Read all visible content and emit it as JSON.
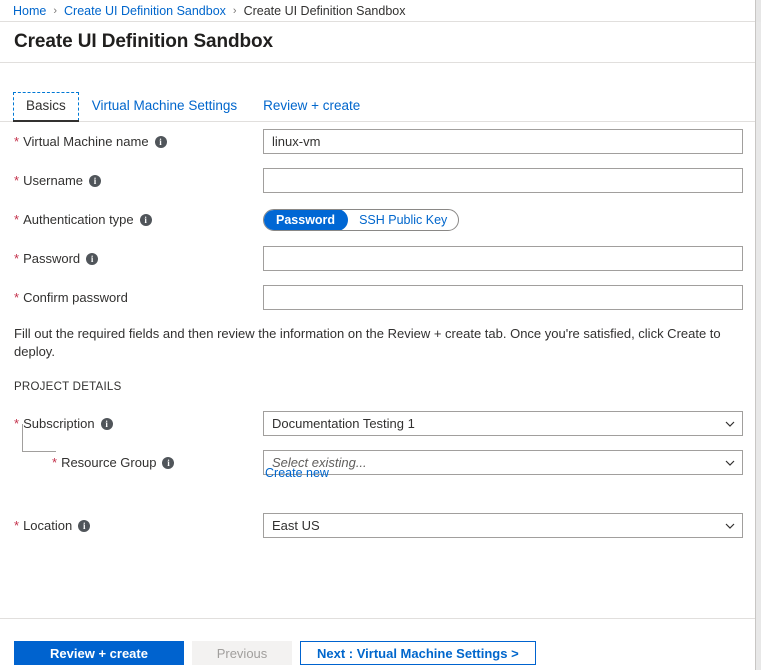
{
  "breadcrumb": {
    "items": [
      {
        "label": "Home",
        "type": "link"
      },
      {
        "label": "Create UI Definition Sandbox",
        "type": "link"
      },
      {
        "label": "Create UI Definition Sandbox",
        "type": "current"
      }
    ],
    "separator": "›"
  },
  "header": {
    "title": "Create UI Definition Sandbox"
  },
  "tabs": [
    {
      "label": "Basics",
      "active": true
    },
    {
      "label": "Virtual Machine Settings",
      "active": false
    },
    {
      "label": "Review + create",
      "active": false
    }
  ],
  "form": {
    "required_marker": "*",
    "info_icon_glyph": "i",
    "fields": [
      {
        "label": "Virtual Machine name",
        "required": true,
        "info": true,
        "control": "text",
        "value": "linux-vm",
        "placeholder": ""
      },
      {
        "label": "Username",
        "required": true,
        "info": true,
        "control": "text",
        "value": "",
        "placeholder": ""
      },
      {
        "label": "Authentication type",
        "required": true,
        "info": true,
        "control": "toggle",
        "options": [
          "Password",
          "SSH Public Key"
        ],
        "selected": "Password"
      },
      {
        "label": "Password",
        "required": true,
        "info": true,
        "control": "text",
        "value": "",
        "placeholder": ""
      },
      {
        "label": "Confirm password",
        "required": true,
        "info": false,
        "control": "text",
        "value": "",
        "placeholder": ""
      }
    ],
    "helptext": "Fill out the required fields and then review the information on the Review + create tab. Once you're satisfied, click Create to deploy.",
    "section_heading": "PROJECT DETAILS",
    "project": [
      {
        "label": "Subscription",
        "required": true,
        "info": true,
        "control": "select",
        "value": "Documentation Testing 1",
        "is_placeholder": false
      },
      {
        "label": "Resource Group",
        "required": true,
        "info": true,
        "control": "select",
        "value": "Select existing...",
        "is_placeholder": true
      },
      {
        "label": "Location",
        "required": true,
        "info": true,
        "control": "select",
        "value": "East US",
        "is_placeholder": false
      }
    ],
    "create_new_link": "Create new"
  },
  "footer": {
    "review_create": "Review + create",
    "previous": "Previous",
    "next": "Next : Virtual Machine Settings >"
  },
  "colors": {
    "accent": "#0067d4",
    "link": "#0066cc",
    "primary_button": "#0063cf",
    "required_star": "#c4314b",
    "border": "#a19f9d",
    "divider": "#e1dfdd"
  }
}
